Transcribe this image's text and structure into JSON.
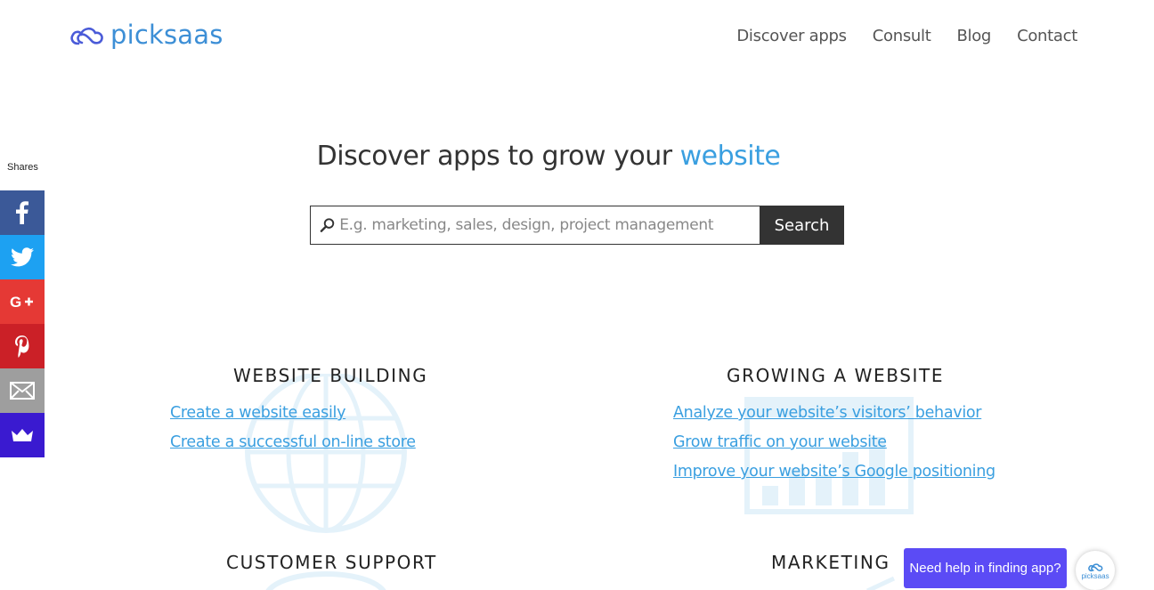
{
  "brand": {
    "name": "picksaas",
    "color": "#3d8fd6"
  },
  "nav": {
    "items": [
      "Discover apps",
      "Consult",
      "Blog",
      "Contact"
    ]
  },
  "share": {
    "label": "Shares",
    "buttons": [
      {
        "icon": "facebook-icon",
        "color": "#3b5998"
      },
      {
        "icon": "twitter-icon",
        "color": "#1da1f2"
      },
      {
        "icon": "google-plus-icon",
        "color": "#e53935"
      },
      {
        "icon": "pinterest-icon",
        "color": "#cb2027"
      },
      {
        "icon": "email-icon",
        "color": "#9e9e9e"
      },
      {
        "icon": "sumome-icon",
        "color": "#3a1ad0"
      }
    ]
  },
  "hero": {
    "title_prefix": "Discover apps to grow your ",
    "title_accent": "website",
    "accent_color": "#3a9fe0"
  },
  "search": {
    "placeholder": "E.g. marketing, sales, design, project management",
    "value": "",
    "button_label": "Search"
  },
  "categories": [
    {
      "title": "WEBSITE BUILDING",
      "icon": "globe-icon",
      "links": [
        "Create a website easily",
        "Create a successful on-line store"
      ]
    },
    {
      "title": "GROWING A WEBSITE",
      "icon": "growth-chart-icon",
      "links": [
        "Analyze your website’s visitors’ behavior",
        "Grow traffic on your website",
        "Improve your website’s Google positioning"
      ]
    },
    {
      "title": "CUSTOMER SUPPORT",
      "icon": "support-icon",
      "links": []
    },
    {
      "title": "MARKETING",
      "icon": "marketing-icon",
      "links": []
    }
  ],
  "help": {
    "label": "Need help in finding app?",
    "avatar_text": "picksaas",
    "color": "#5b4bf5"
  }
}
